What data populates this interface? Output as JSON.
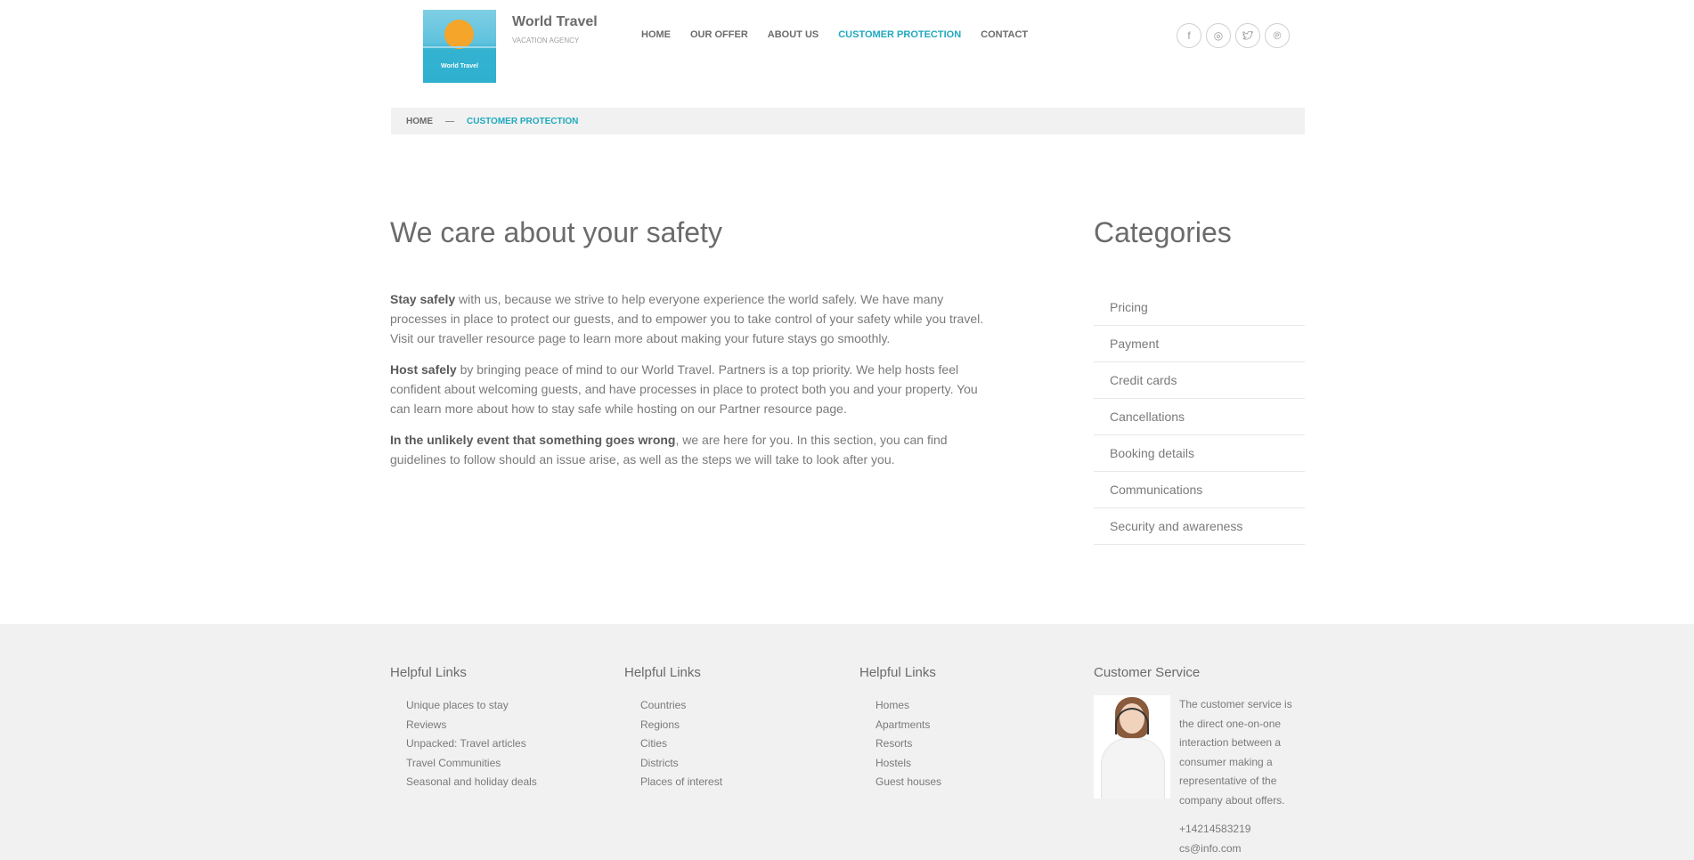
{
  "header": {
    "logo_text": "World Travel",
    "brand_name": "World Travel",
    "brand_tagline": "VACATION AGENCY",
    "nav": [
      {
        "label": "HOME"
      },
      {
        "label": "OUR OFFER"
      },
      {
        "label": "ABOUT US"
      },
      {
        "label": "CUSTOMER PROTECTION"
      },
      {
        "label": "CONTACT"
      }
    ],
    "social": [
      {
        "icon": "facebook-icon",
        "glyph": "f"
      },
      {
        "icon": "instagram-icon",
        "glyph": "◎"
      },
      {
        "icon": "twitter-icon",
        "glyph": "🐦"
      },
      {
        "icon": "pinterest-icon",
        "glyph": "℗"
      }
    ]
  },
  "breadcrumb": {
    "home": "HOME",
    "separator": "—",
    "current": "CUSTOMER PROTECTION"
  },
  "main": {
    "title": "We care about your safety",
    "paragraphs": [
      {
        "bold": "Stay safely",
        "text": " with us, because we strive to help everyone experience the world safely. We have many processes in place to protect our guests, and to empower you to take control of your safety while you travel. Visit our traveller resource page to learn more about making your future stays go smoothly."
      },
      {
        "bold": "Host safely",
        "text": " by bringing peace of mind to our World Travel. Partners is a top priority. We help hosts feel confident about welcoming guests, and have processes in place to protect both you and your property. You can learn more about how to stay safe while hosting on our Partner resource page."
      },
      {
        "bold": "In the unlikely event that something goes wrong",
        "text": ", we are here for you. In this section, you can find guidelines to follow should an issue arise, as well as the steps we will take to look after you."
      }
    ]
  },
  "sidebar": {
    "title": "Categories",
    "items": [
      {
        "label": "Pricing"
      },
      {
        "label": "Payment"
      },
      {
        "label": "Credit cards"
      },
      {
        "label": "Cancellations"
      },
      {
        "label": "Booking details"
      },
      {
        "label": "Communications"
      },
      {
        "label": "Security and awareness"
      }
    ]
  },
  "footer": {
    "columns": [
      {
        "title": "Helpful Links",
        "links": [
          "Unique places to stay",
          "Reviews",
          "Unpacked: Travel articles",
          "Travel Communities",
          "Seasonal and holiday deals"
        ]
      },
      {
        "title": "Helpful Links",
        "links": [
          "Countries",
          "Regions",
          "Cities",
          "Districts",
          "Places of interest"
        ]
      },
      {
        "title": "Helpful Links",
        "links": [
          "Homes",
          "Apartments",
          "Resorts",
          "Hostels",
          "Guest houses"
        ]
      }
    ],
    "customer_service": {
      "title": "Customer Service",
      "description": "The customer service is the direct one-on-one interaction between a consumer making a representative of the company about offers.",
      "phone": "+14214583219",
      "email": "cs@info.com"
    }
  },
  "colors": {
    "accent": "#1fa9bd",
    "text": "#7a7a7a",
    "heading": "#6b6b6b",
    "footer_bg": "#f1f1f1"
  }
}
